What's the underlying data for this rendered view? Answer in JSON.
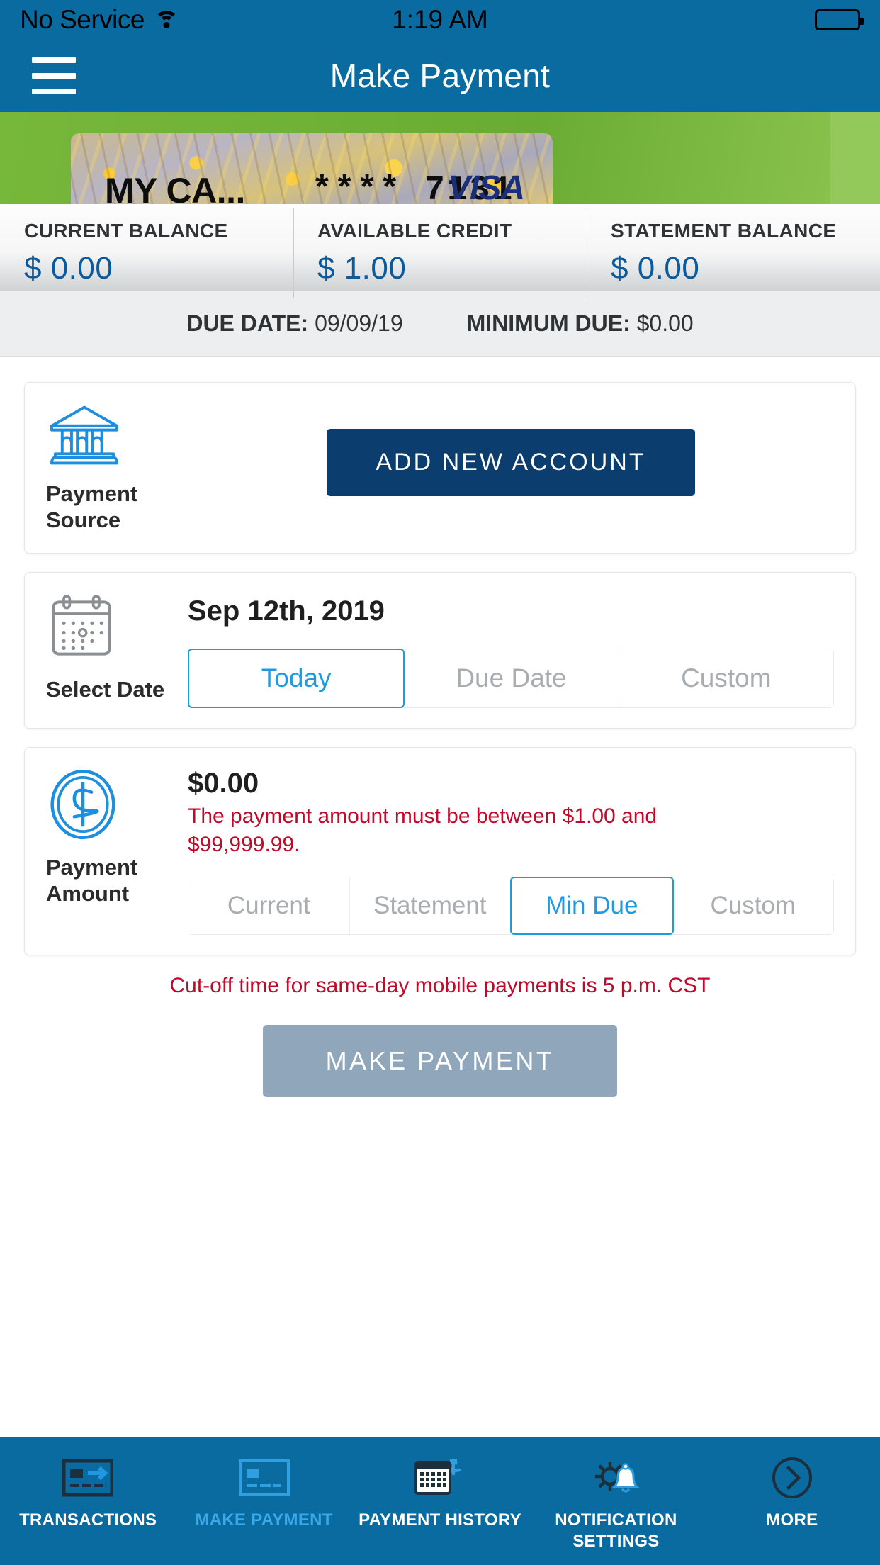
{
  "status_bar": {
    "carrier": "No Service",
    "wifi_icon": "wifi-icon",
    "time": "1:19 AM",
    "battery_icon": "battery-full-icon"
  },
  "header": {
    "menu_icon": "hamburger-menu-icon",
    "title": "Make Payment"
  },
  "card": {
    "nickname": "MY CA...",
    "masked_number": "**** 7131",
    "brand": "VISA"
  },
  "balances": [
    {
      "label": "CURRENT BALANCE",
      "value": "$ 0.00"
    },
    {
      "label": "AVAILABLE CREDIT",
      "value": "$ 1.00"
    },
    {
      "label": "STATEMENT BALANCE",
      "value": "$ 0.00"
    }
  ],
  "due_row": {
    "due_date_label": "DUE DATE:",
    "due_date_value": "09/09/19",
    "minimum_due_label": "MINIMUM DUE:",
    "minimum_due_value": "$0.00"
  },
  "payment_source": {
    "icon": "bank-icon",
    "label": "Payment Source",
    "add_account_button": "ADD NEW ACCOUNT"
  },
  "select_date": {
    "icon": "calendar-icon",
    "label": "Select Date",
    "selected_date": "Sep 12th, 2019",
    "options": [
      {
        "label": "Today",
        "selected": true
      },
      {
        "label": "Due Date",
        "selected": false
      },
      {
        "label": "Custom",
        "selected": false
      }
    ]
  },
  "payment_amount": {
    "icon": "dollar-coin-icon",
    "label": "Payment Amount",
    "amount": "$0.00",
    "error": "The payment amount must be between $1.00 and $99,999.99.",
    "options": [
      {
        "label": "Current",
        "selected": false
      },
      {
        "label": "Statement",
        "selected": false
      },
      {
        "label": "Min Due",
        "selected": true
      },
      {
        "label": "Custom",
        "selected": false
      }
    ]
  },
  "footer": {
    "cutoff_notice": "Cut-off time for same-day mobile payments is 5 p.m. CST",
    "submit_button": "MAKE PAYMENT"
  },
  "tabs": [
    {
      "label": "TRANSACTIONS",
      "icon": "card-arrow-icon",
      "active": false
    },
    {
      "label": "MAKE PAYMENT",
      "icon": "card-icon",
      "active": true
    },
    {
      "label": "PAYMENT HISTORY",
      "icon": "calendar-dollar-icon",
      "active": false
    },
    {
      "label": "NOTIFICATION SETTINGS",
      "icon": "gear-bell-icon",
      "active": false
    },
    {
      "label": "MORE",
      "icon": "chevron-right-circle-icon",
      "active": false
    }
  ],
  "colors": {
    "brand_blue": "#0a6ba0",
    "accent_blue": "#1e9ae0",
    "dark_navy": "#0b3d6e",
    "error_red": "#c10a2b",
    "banner_green": "#6aac33",
    "disabled_gray": "#8fa6bb"
  }
}
